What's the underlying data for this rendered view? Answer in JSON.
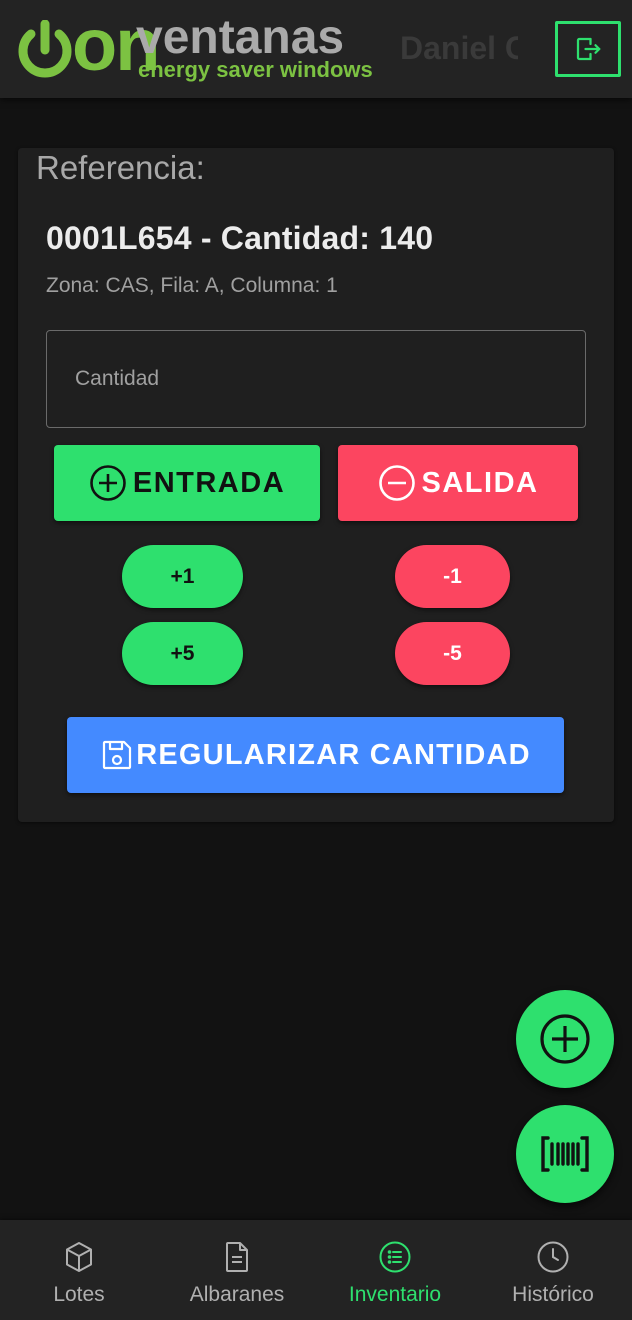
{
  "header": {
    "logo": {
      "mark": "on",
      "brand": "ventanas",
      "tagline": "energy saver windows"
    },
    "user_name": "Daniel C",
    "logout_icon": "logout-icon"
  },
  "card": {
    "label": "Referencia:",
    "reference_title": "0001L654 - Cantidad: 140",
    "location": "Zona: CAS, Fila: A, Columna: 1",
    "quantity_input": {
      "placeholder": "Cantidad",
      "value": ""
    },
    "entrada_label": "ENTRADA",
    "salida_label": "SALIDA",
    "increments": [
      "+1",
      "+5"
    ],
    "decrements": [
      "-1",
      "-5"
    ],
    "regularizar_label": "REGULARIZAR CANTIDAD"
  },
  "fabs": {
    "add_icon": "plus-circle-icon",
    "scan_icon": "barcode-icon"
  },
  "bottom_nav": {
    "items": [
      {
        "label": "Lotes",
        "icon": "cube-icon",
        "active": false
      },
      {
        "label": "Albaranes",
        "icon": "document-icon",
        "active": false
      },
      {
        "label": "Inventario",
        "icon": "list-icon",
        "active": true
      },
      {
        "label": "Histórico",
        "icon": "clock-icon",
        "active": false
      }
    ]
  },
  "colors": {
    "accent_green": "#2ee06e",
    "danger_red": "#fc4560",
    "primary_blue": "#448aff",
    "logo_green": "#7cc242",
    "background": "#121212",
    "surface": "#1f1f1f"
  }
}
